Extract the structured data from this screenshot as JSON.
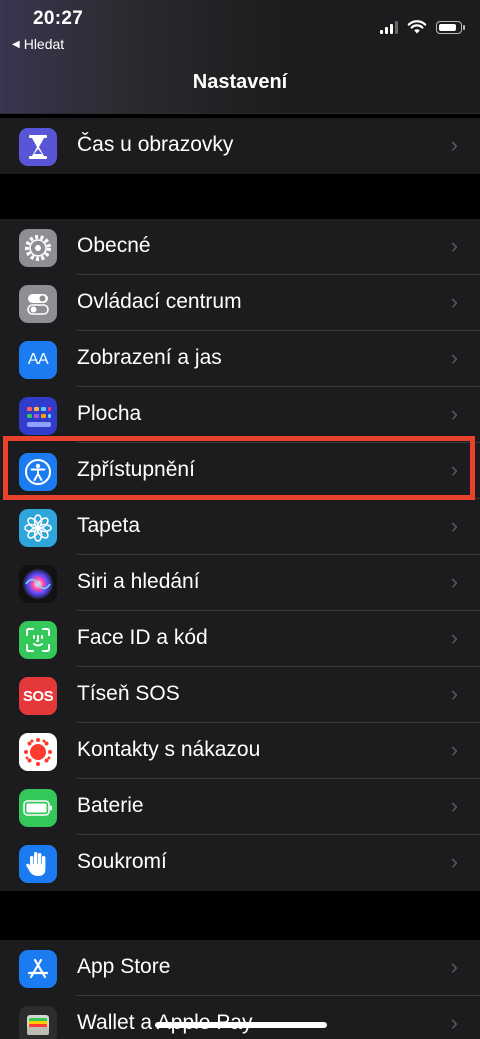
{
  "status_bar": {
    "time": "20:27",
    "back_label": "Hledat"
  },
  "nav": {
    "title": "Nastavení"
  },
  "group1": [
    {
      "label": "Čas u obrazovky",
      "icon": "hourglass-icon",
      "color": "#5856d6"
    }
  ],
  "group2": [
    {
      "label": "Obecné",
      "icon": "gear-icon",
      "color": "#8e8e93"
    },
    {
      "label": "Ovládací centrum",
      "icon": "toggles-icon",
      "color": "#8e8e93"
    },
    {
      "label": "Zobrazení a jas",
      "icon": "text-size-icon",
      "color": "#1a7cf0"
    },
    {
      "label": "Plocha",
      "icon": "grid-icon",
      "color": "#2f3dca"
    },
    {
      "label": "Zpřístupnění",
      "icon": "accessibility-icon",
      "color": "#1a7cf0"
    },
    {
      "label": "Tapeta",
      "icon": "flower-icon",
      "color": "#2ea6d9"
    },
    {
      "label": "Siri a hledání",
      "icon": "siri-icon",
      "color": "#111111"
    },
    {
      "label": "Face ID a kód",
      "icon": "face-id-icon",
      "color": "#34c759"
    },
    {
      "label": "Tíseň SOS",
      "icon": "sos-icon",
      "color": "#e5383b"
    },
    {
      "label": "Kontakty s nákazou",
      "icon": "exposure-icon",
      "color": "#ffffff"
    },
    {
      "label": "Baterie",
      "icon": "battery-icon",
      "color": "#34c759"
    },
    {
      "label": "Soukromí",
      "icon": "hand-icon",
      "color": "#1a7cf0"
    }
  ],
  "group3": [
    {
      "label": "App Store",
      "icon": "app-store-icon",
      "color": "#1a7cf0"
    },
    {
      "label": "Wallet a Apple Pay",
      "icon": "wallet-icon",
      "color": "#2c2c2e"
    }
  ],
  "icons": {
    "sos_text": "SOS",
    "text_size_glyph": "AA",
    "chevron": "›"
  },
  "highlight_color": "#e8412c"
}
